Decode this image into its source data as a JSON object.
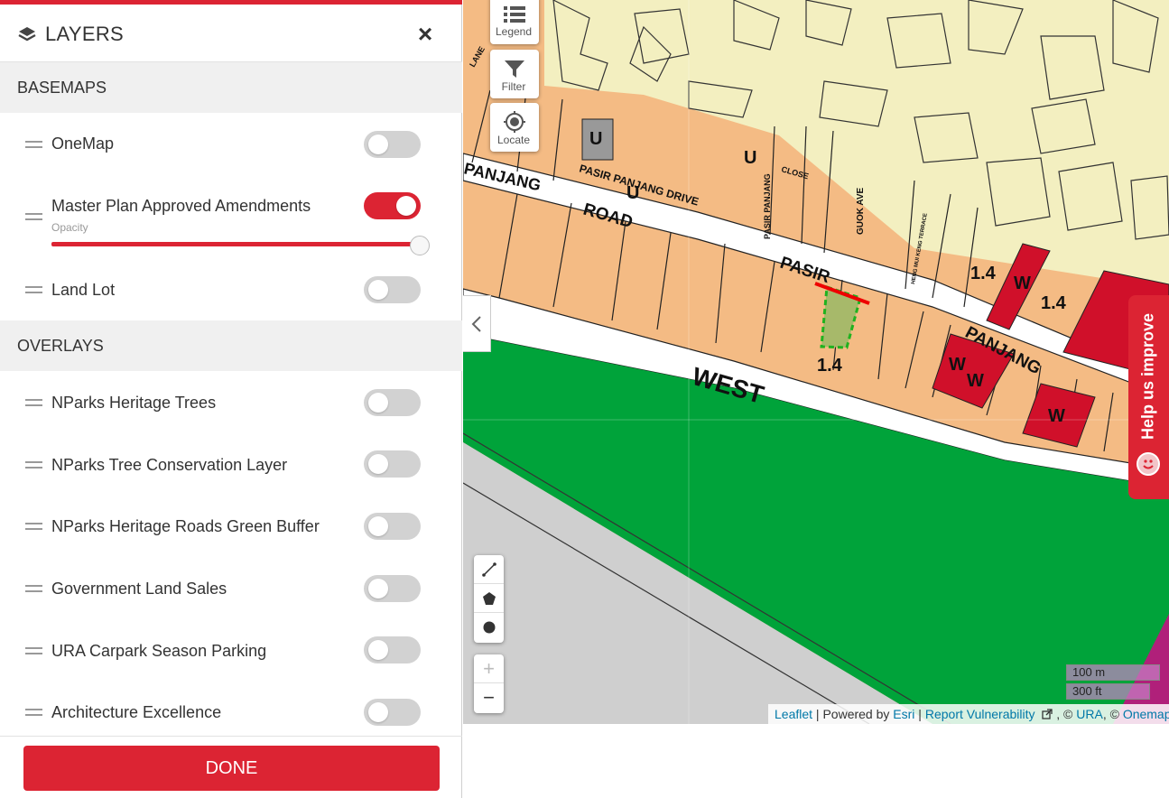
{
  "panel": {
    "title": "LAYERS",
    "close_icon": "×",
    "basemaps_heading": "BASEMAPS",
    "basemaps": [
      {
        "label": "OneMap",
        "enabled": false
      },
      {
        "label": "Master Plan Approved Amendments",
        "enabled": true
      },
      {
        "label": "Land Lot",
        "enabled": false
      }
    ],
    "opacity_label": "Opacity",
    "opacity_value": 1.0,
    "overlays_heading": "OVERLAYS",
    "overlays": [
      {
        "label": "NParks Heritage Trees",
        "enabled": false
      },
      {
        "label": "NParks Tree Conservation Layer",
        "enabled": false
      },
      {
        "label": "NParks Heritage Roads Green Buffer",
        "enabled": false
      },
      {
        "label": "Government Land Sales",
        "enabled": false
      },
      {
        "label": "URA Carpark Season Parking",
        "enabled": false
      },
      {
        "label": "Architecture Excellence",
        "enabled": false
      }
    ],
    "done_label": "DONE"
  },
  "map": {
    "controls": {
      "legend_label": "Legend",
      "filter_label": "Filter",
      "locate_label": "Locate"
    },
    "road_labels": {
      "panjang_top": "PANJANG",
      "road": "ROAD",
      "pasir": "PASIR",
      "panjang_right": "PANJANG",
      "west": "WEST",
      "pasir_panjang_drive": "PASIR   PANJANG   DRIVE",
      "pasir_panjang_vertical": "PASIR PANJANG",
      "close": "CLOSE",
      "guok_ave": "GUOK AVE",
      "lane": "LANE",
      "heng_terrace": "HENG MUI KENG TERRACE"
    },
    "zone_labels": {
      "plot_ratio": "1.4",
      "white_zone": "W",
      "utility": "U"
    },
    "help_label": "Help us improve",
    "zoom_in": "+",
    "zoom_out": "−",
    "scale_metric": "100 m",
    "scale_imperial": "300 ft",
    "attribution": {
      "leaflet": "Leaflet",
      "powered_by": " | Powered by ",
      "esri": "Esri",
      "sep": " | ",
      "report": "Report Vulnerability",
      "copyright_sep": " , © ",
      "ura": "URA",
      "comma": ", © ",
      "onemap": "Onemap"
    },
    "colors": {
      "residential": "#f4bb84",
      "landed": "#f3efc0",
      "park": "#00a33a",
      "commercial": "#d0102a",
      "road": "#ffffff",
      "accent": "#dc2433"
    }
  }
}
